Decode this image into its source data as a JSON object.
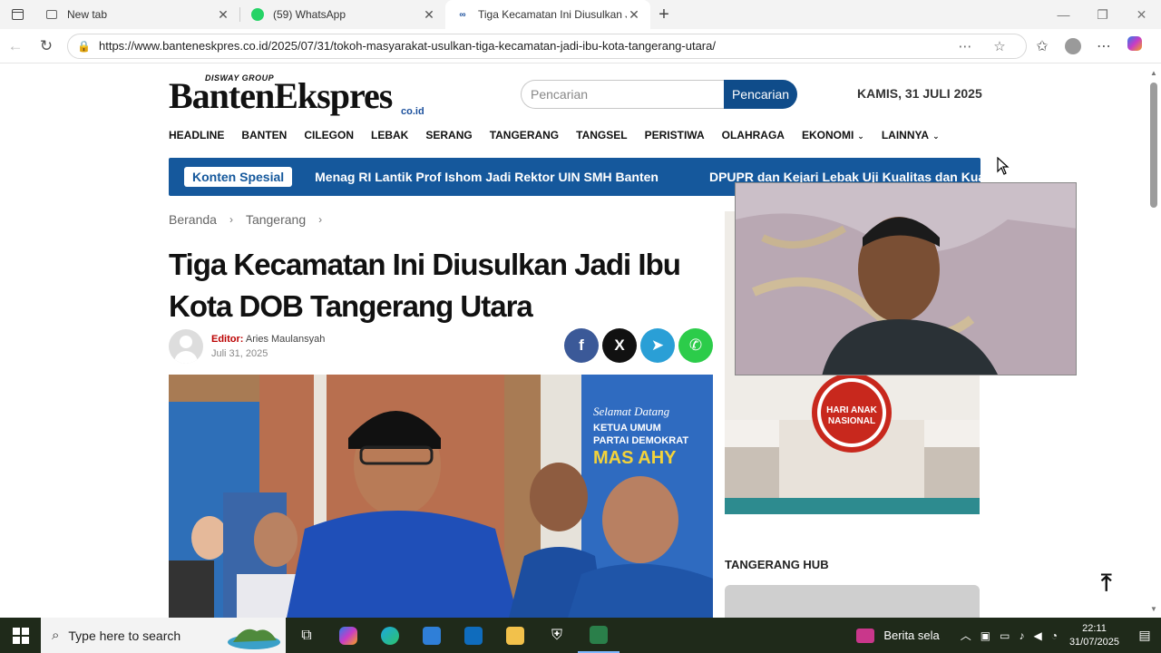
{
  "browser": {
    "tabs": [
      {
        "title": "New tab",
        "active": false
      },
      {
        "title": "(59) WhatsApp",
        "active": false
      },
      {
        "title": "Tiga Kecamatan Ini Diusulkan Jadi Ibu Kota",
        "active": true
      }
    ],
    "url": "https://www.banteneskpres.co.id/2025/07/31/tokoh-masyarakat-usulkan-tiga-kecamatan-jadi-ibu-kota-tangerang-utara/"
  },
  "site": {
    "logo_group": "DISWAY GROUP",
    "logo_main": "BantenEkspres",
    "logo_domain": "co.id",
    "search_placeholder": "Pencarian",
    "search_button": "Pencarian",
    "date": "KAMIS, 31 JULI 2025",
    "nav": [
      {
        "label": "HEADLINE",
        "dropdown": false
      },
      {
        "label": "BANTEN",
        "dropdown": false
      },
      {
        "label": "CILEGON",
        "dropdown": false
      },
      {
        "label": "LEBAK",
        "dropdown": false
      },
      {
        "label": "SERANG",
        "dropdown": false
      },
      {
        "label": "TANGERANG",
        "dropdown": false
      },
      {
        "label": "TANGSEL",
        "dropdown": false
      },
      {
        "label": "PERISTIWA",
        "dropdown": false
      },
      {
        "label": "OLAHRAGA",
        "dropdown": false
      },
      {
        "label": "EKONOMI",
        "dropdown": true
      },
      {
        "label": "LAINNYA",
        "dropdown": true
      }
    ],
    "ticker": {
      "label": "Konten Spesial",
      "items": [
        "Menag RI Lantik Prof Ishom Jadi Rektor UIN SMH Banten",
        "DPUPR dan Kejari Lebak Uji Kualitas dan Kuantit"
      ]
    }
  },
  "article": {
    "breadcrumb": [
      "Beranda",
      "Tangerang"
    ],
    "title": "Tiga Kecamatan Ini Diusulkan Jadi Ibu Kota DOB Tangerang Utara",
    "editor_label": "Editor:",
    "editor_name": "Aries Maulansyah",
    "date": "Juli 31, 2025",
    "share": [
      {
        "name": "facebook",
        "glyph": "f",
        "color": "#3b5998"
      },
      {
        "name": "x",
        "glyph": "X",
        "color": "#111111"
      },
      {
        "name": "telegram",
        "glyph": "➤",
        "color": "#2a9fd6"
      },
      {
        "name": "whatsapp",
        "glyph": "✆",
        "color": "#2ccc4a"
      }
    ]
  },
  "sidebar": {
    "ad_text": "HARI ANAK NASIONAL",
    "section_title": "TANGERANG HUB"
  },
  "taskbar": {
    "search_placeholder": "Type here to search",
    "news_label": "Berita sela",
    "time": "22:11",
    "date": "31/07/2025"
  }
}
